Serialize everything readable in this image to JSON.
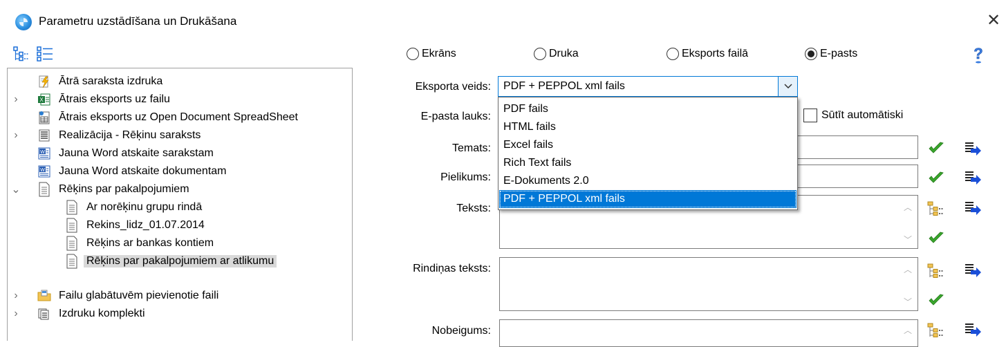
{
  "window": {
    "title": "Parametru uzstādīšana un Drukāšana",
    "close_glyph": "✕"
  },
  "toolbar": {
    "icons": [
      "tree-expand-icon",
      "tree-list-icon"
    ]
  },
  "tree": {
    "items": [
      {
        "label": "Ātrā saraksta izdruka",
        "icon": "lightning-icon",
        "expander": ""
      },
      {
        "label": "Ātrais eksports uz failu",
        "icon": "excel-icon",
        "expander": "›"
      },
      {
        "label": "Ātrais eksports uz Open Document SpreadSheet",
        "icon": "ods-icon",
        "expander": ""
      },
      {
        "label": "Realizācija - Rēķinu saraksts",
        "icon": "list-report-icon",
        "expander": "›"
      },
      {
        "label": "Jauna Word atskaite sarakstam",
        "icon": "word-icon",
        "expander": ""
      },
      {
        "label": "Jauna Word atskaite dokumentam",
        "icon": "word-icon",
        "expander": ""
      },
      {
        "label": "Rēķins par pakalpojumiem",
        "icon": "document-icon",
        "expander": "⌄"
      },
      {
        "label": "Ar norēķinu grupu rindā",
        "icon": "document-icon",
        "expander": ""
      },
      {
        "label": "Rekins_lidz_01.07.2014",
        "icon": "document-icon",
        "expander": ""
      },
      {
        "label": "Rēķins ar bankas kontiem",
        "icon": "document-icon",
        "expander": ""
      },
      {
        "label": "Rēķins par pakalpojumiem ar atlikumu",
        "icon": "document-icon",
        "expander": "",
        "selected": true
      },
      {
        "label": "Failu glabātuvēm pievienotie faili",
        "icon": "folder-icon",
        "expander": "›"
      },
      {
        "label": "Izdruku komplekti",
        "icon": "print-set-icon",
        "expander": "›"
      }
    ]
  },
  "output": {
    "options": [
      {
        "label": "Ekrāns",
        "checked": false
      },
      {
        "label": "Druka",
        "checked": false
      },
      {
        "label": "Eksports failā",
        "checked": false
      },
      {
        "label": "E-pasts",
        "checked": true
      }
    ],
    "help_icon": "help-icon"
  },
  "form": {
    "export_type_label": "Eksporta veids:",
    "export_type_value": "PDF + PEPPOL xml fails",
    "email_field_label": "E-pasta lauks:",
    "auto_send_label": "Sūtīt automātiski",
    "auto_send_checked": false,
    "subject_label": "Temats:",
    "attachment_label": "Pielikums:",
    "text_label": "Teksts:",
    "row_text_label": "Rindiņas teksts:",
    "ending_label": "Nobeigums:"
  },
  "dropdown": {
    "options": [
      "PDF fails",
      "HTML fails",
      "Excel fails",
      "Rich Text fails",
      "E-Dokuments 2.0",
      "PDF + PEPPOL xml fails"
    ],
    "selected": "PDF + PEPPOL xml fails"
  },
  "colors": {
    "accent": "#0078d7",
    "check_green": "#3aa62c",
    "insert_blue": "#1b4fd8",
    "selection_gray": "#d9d9d9"
  }
}
